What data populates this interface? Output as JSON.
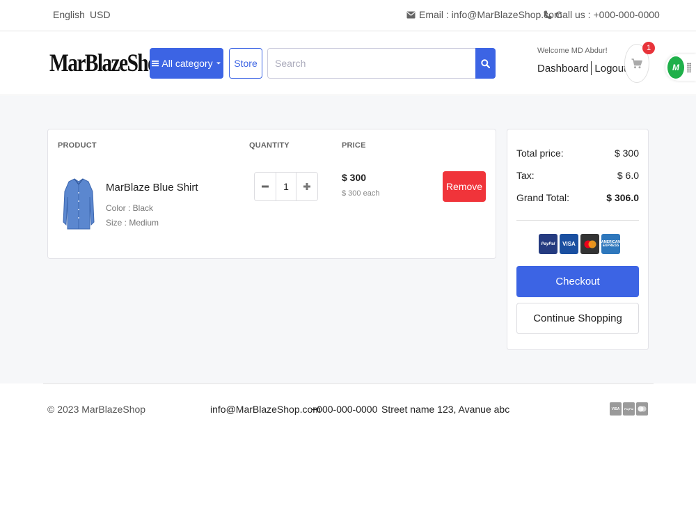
{
  "topbar": {
    "language": "English",
    "currency": "USD",
    "email": "Email : info@MarBlazeShop.com",
    "call": "Call us : +000-000-0000"
  },
  "header": {
    "logo": "MarBlazeShop",
    "category_label": "All category",
    "store_label": "Store",
    "search_placeholder": "Search",
    "welcome": "Welcome MD Abdur!",
    "dashboard": "Dashboard",
    "logout": "Logout",
    "cart_count": "1",
    "extension_label": "M"
  },
  "cart": {
    "columns": [
      "PRODUCT",
      "QUANTITY",
      "PRICE"
    ],
    "items": [
      {
        "name": "MarBlaze Blue Shirt",
        "color": "Color : Black",
        "size": "Size : Medium",
        "quantity": "1",
        "price": "$ 300",
        "price_each": "$ 300 each",
        "remove_label": "Remove"
      }
    ]
  },
  "summary": {
    "total_label": "Total price:",
    "total_value": "$ 300",
    "tax_label": "Tax:",
    "tax_value": "$ 6.0",
    "grand_label": "Grand Total:",
    "grand_value": "$ 306.0",
    "payment_methods": [
      "PayPal",
      "VISA",
      "Mastercard",
      "American Express"
    ],
    "paypal_text": "PayPal",
    "visa_text": "VISA",
    "amex_text": "AMERICAN EXPRESS",
    "checkout_label": "Checkout",
    "continue_label": "Continue Shopping"
  },
  "footer": {
    "copyright": "© 2023 MarBlazeShop",
    "email": "info@MarBlazeShop.com",
    "phone": "+000-000-0000",
    "address": "Street name 123, Avanue abc",
    "visa_text": "VISA",
    "paypal_text": "PayPal"
  },
  "colors": {
    "primary": "#3c64e4",
    "danger": "#f0343a",
    "badge": "#e8333a",
    "background": "#f6f7f9"
  }
}
